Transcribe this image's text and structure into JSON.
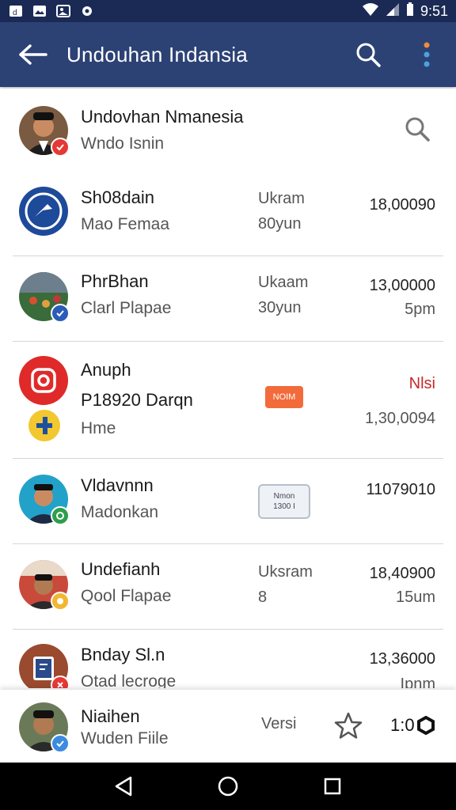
{
  "status_bar": {
    "time": "9:51"
  },
  "app_bar": {
    "title": "Undouhan Indansia"
  },
  "header": {
    "name": "Undovhan Nmanesia",
    "subtitle": "Wndo Isnin"
  },
  "rows": [
    {
      "name": "Sh08dain",
      "sub": "Mao Femaa",
      "mid1": "Ukram",
      "mid2": "80yun",
      "amount": "18,00090",
      "amount2": ""
    },
    {
      "name": "PhrBhan",
      "sub": "Clarl Plapae",
      "mid1": "Ukaam",
      "mid2": "30yun",
      "amount": "13,00000",
      "amount2": "5pm"
    },
    {
      "name": "Anuph",
      "sub": "P18920 Darqn",
      "sub2": "Hme",
      "chip": "NOIM",
      "amount": "Nlsi",
      "amount2": "1,30,0094"
    },
    {
      "name": "Vldavnnn",
      "sub": "Madonkan",
      "chip_line1": "Nmon",
      "chip_line2": "1300 I",
      "amount": "11079010"
    },
    {
      "name": "Undefianh",
      "sub": "Qool Flapae",
      "mid1": "Uksram",
      "mid2": "8",
      "amount": "18,40900",
      "amount2": "15um"
    },
    {
      "name": "Bnday Sl.n",
      "sub": "Otad lecroge",
      "amount": "13,36000",
      "amount2": "Ipnm"
    }
  ],
  "bottom": {
    "name": "Niaihen",
    "sub": "Wuden Fiile",
    "versi": "Versi",
    "count": "1:0"
  },
  "colors": {
    "app_bar": "#2c4275",
    "status_bar": "#1b2a55",
    "accent_red": "#c62828"
  }
}
